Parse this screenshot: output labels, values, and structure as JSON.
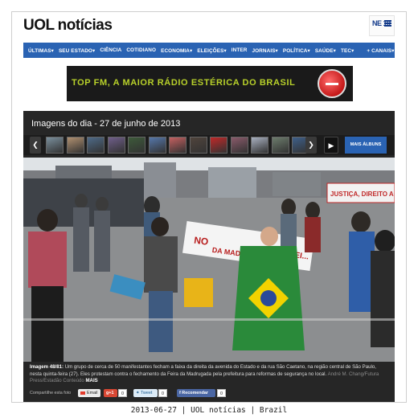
{
  "masthead": {
    "brand": "UOL",
    "section": "notícias",
    "partner_logo": "NE 10"
  },
  "nav": {
    "items": [
      "ÚLTIMAS▾",
      "SEU ESTADO▾",
      "CIÊNCIA",
      "COTIDIANO",
      "ECONOMIA▾",
      "ELEIÇÕES▾",
      "INTER",
      "JORNAIS▾",
      "POLÍTICA▾",
      "SAÚDE▾",
      "TEC▾",
      "+ CANAIS▾"
    ]
  },
  "ad": {
    "text": "TOP FM, A MAIOR RÁDIO ESTÉRICA DO BRASIL"
  },
  "gallery": {
    "title": "Imagens do dia - 27 de junho de 2013",
    "prev_icon": "chevron-left-icon",
    "next_icon": "chevron-right-icon",
    "play_icon": "play-icon",
    "more_albums_label": "MAIS ÁLBUNS",
    "thumb_colors": [
      "#7a8f9c",
      "#b09070",
      "#4e6a88",
      "#6f5e8a",
      "#3d5a3a",
      "#5577aa",
      "#c46060",
      "#50443c",
      "#c02828",
      "#8a5a6a",
      "#a8b0c0",
      "#6c7c6c",
      "#3e5f8a"
    ],
    "photo": {
      "banner_text": "JUSTIÇA, DIREITO A TRABALHAR",
      "sign_left": "NO",
      "sign_mid": "DA MADRUGADA",
      "sign_right": "OS REI...",
      "sky_color": "#dfe3e6",
      "road_color": "#8c8e90"
    },
    "caption": {
      "label": "Imagem 48/81:",
      "text": "Um grupo de cerca de 50 manifestantes fecham a faixa da direita da avenida do Estado e da rua São Caetano, na região central de São Paulo, nesta quinta-feira (27). Eles protestam contra o fechamento da Feira da Madrugada pela prefeitura para reformas de segurança no local.",
      "credit": "André M. Chang/Futura Press/Estadão Conteúdo",
      "more": "MAIS"
    },
    "share": {
      "label": "Compartilhe esta foto",
      "email": "Email",
      "gplus": "g+1",
      "gplus_count": "0",
      "tweet": "Tweet",
      "tweet_count": "0",
      "facebook": "Recomendar",
      "facebook_count": "0"
    }
  },
  "footer": {
    "text": "2013-06-27 | UOL notícias | Brazil"
  },
  "colors": {
    "nav_blue": "#2a63b3",
    "gallery_bg": "#262626"
  }
}
